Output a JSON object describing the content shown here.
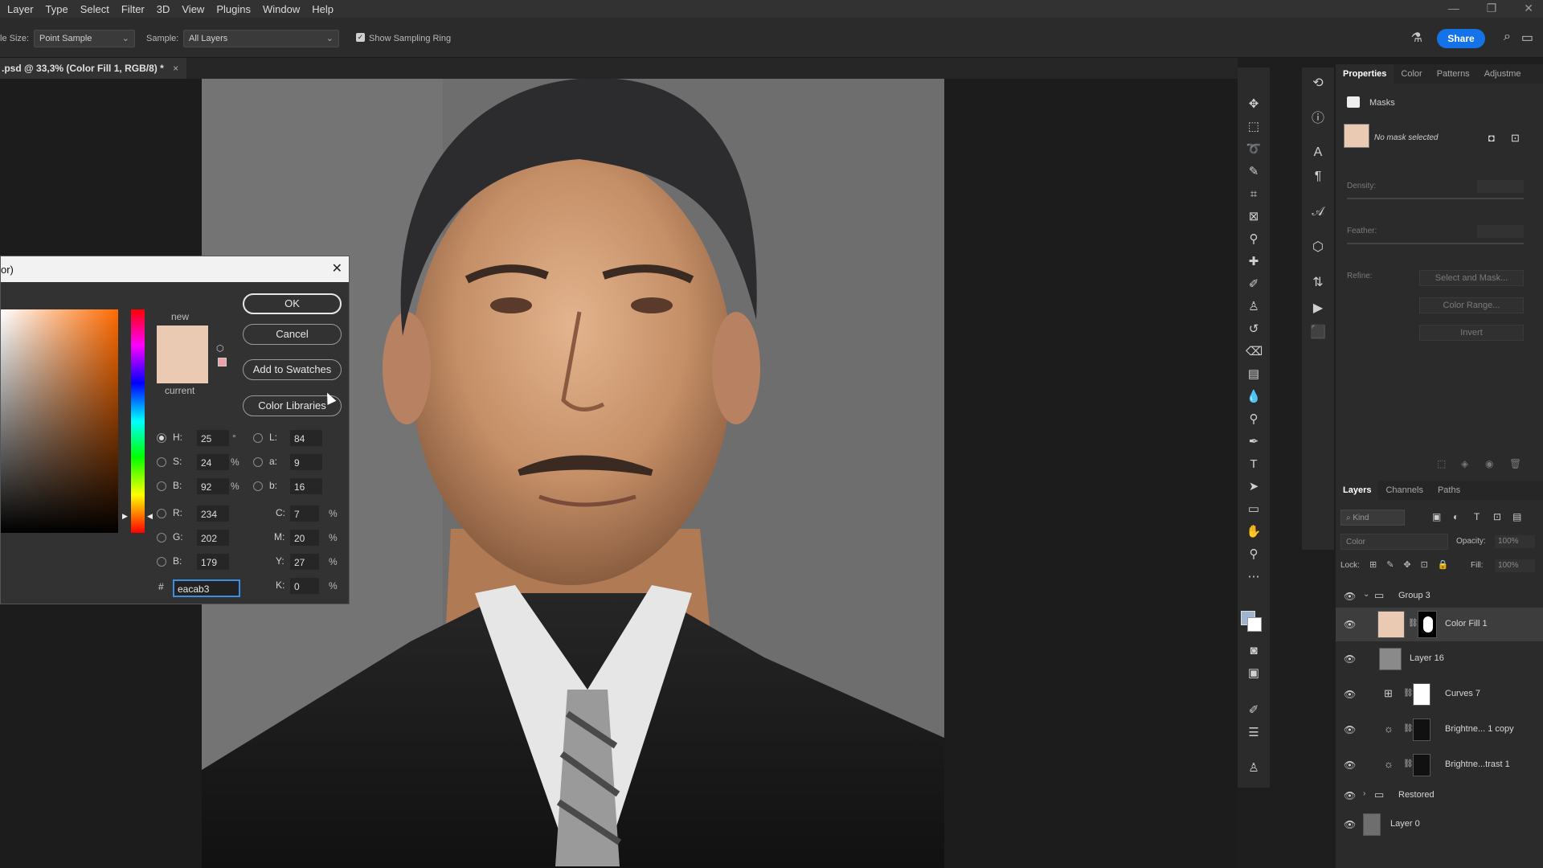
{
  "menu": [
    "Layer",
    "Type",
    "Select",
    "Filter",
    "3D",
    "View",
    "Plugins",
    "Window",
    "Help"
  ],
  "options": {
    "sample_size_label": "le Size:",
    "sample_size_value": "Point Sample",
    "sample_label": "Sample:",
    "sample_value": "All Layers",
    "sampling_ring_label": "Show Sampling Ring",
    "share_label": "Share"
  },
  "document": {
    "tab_title": ".psd @ 33,3% (Color Fill 1, RGB/8) *",
    "close_glyph": "×"
  },
  "properties": {
    "tabs": [
      "Properties",
      "Color",
      "Patterns",
      "Adjustme"
    ],
    "section": "Masks",
    "no_mask_text": "No mask selected",
    "density_label": "Density:",
    "feather_label": "Feather:",
    "refine_label": "Refine:",
    "select_mask_btn": "Select and Mask...",
    "color_range_btn": "Color Range...",
    "invert_btn": "Invert"
  },
  "layers_panel": {
    "tabs": [
      "Layers",
      "Channels",
      "Paths"
    ],
    "kind_placeholder": "Kind",
    "blend_mode": "Color",
    "opacity_label": "Opacity:",
    "opacity_value": "100%",
    "lock_label": "Lock:",
    "fill_label": "Fill:",
    "fill_value": "100%",
    "layers": [
      {
        "name": "Group 3"
      },
      {
        "name": "Color Fill 1"
      },
      {
        "name": "Layer 16"
      },
      {
        "name": "Curves 7"
      },
      {
        "name": "Brightne... 1 copy"
      },
      {
        "name": "Brightne...trast 1"
      },
      {
        "name": "Restored"
      },
      {
        "name": "Layer 0"
      }
    ]
  },
  "color_picker": {
    "title": "or)",
    "new_label": "new",
    "current_label": "current",
    "ok": "OK",
    "cancel": "Cancel",
    "add_swatches": "Add to Swatches",
    "color_libraries": "Color Libraries",
    "h_label": "H:",
    "h_value": "25",
    "h_unit": "°",
    "s_label": "S:",
    "s_value": "24",
    "s_unit": "%",
    "b_label": "B:",
    "b_value": "92",
    "b_unit": "%",
    "r_label": "R:",
    "r_value": "234",
    "g_label": "G:",
    "g_value": "202",
    "bb_label": "B:",
    "bb_value": "179",
    "l_label": "L:",
    "l_value": "84",
    "a_label": "a:",
    "a_value": "9",
    "lab_b_label": "b:",
    "lab_b_value": "16",
    "c_label": "C:",
    "c_value": "7",
    "m_label": "M:",
    "m_value": "20",
    "y_label": "Y:",
    "y_value": "27",
    "k_label": "K:",
    "k_value": "0",
    "pct": "%",
    "hash": "#",
    "hex_value": "eacab3",
    "new_color": "#eacab3",
    "current_color": "#eacab3"
  },
  "colors": {
    "accent": "#1473e6",
    "fill_color": "#eacab3"
  }
}
